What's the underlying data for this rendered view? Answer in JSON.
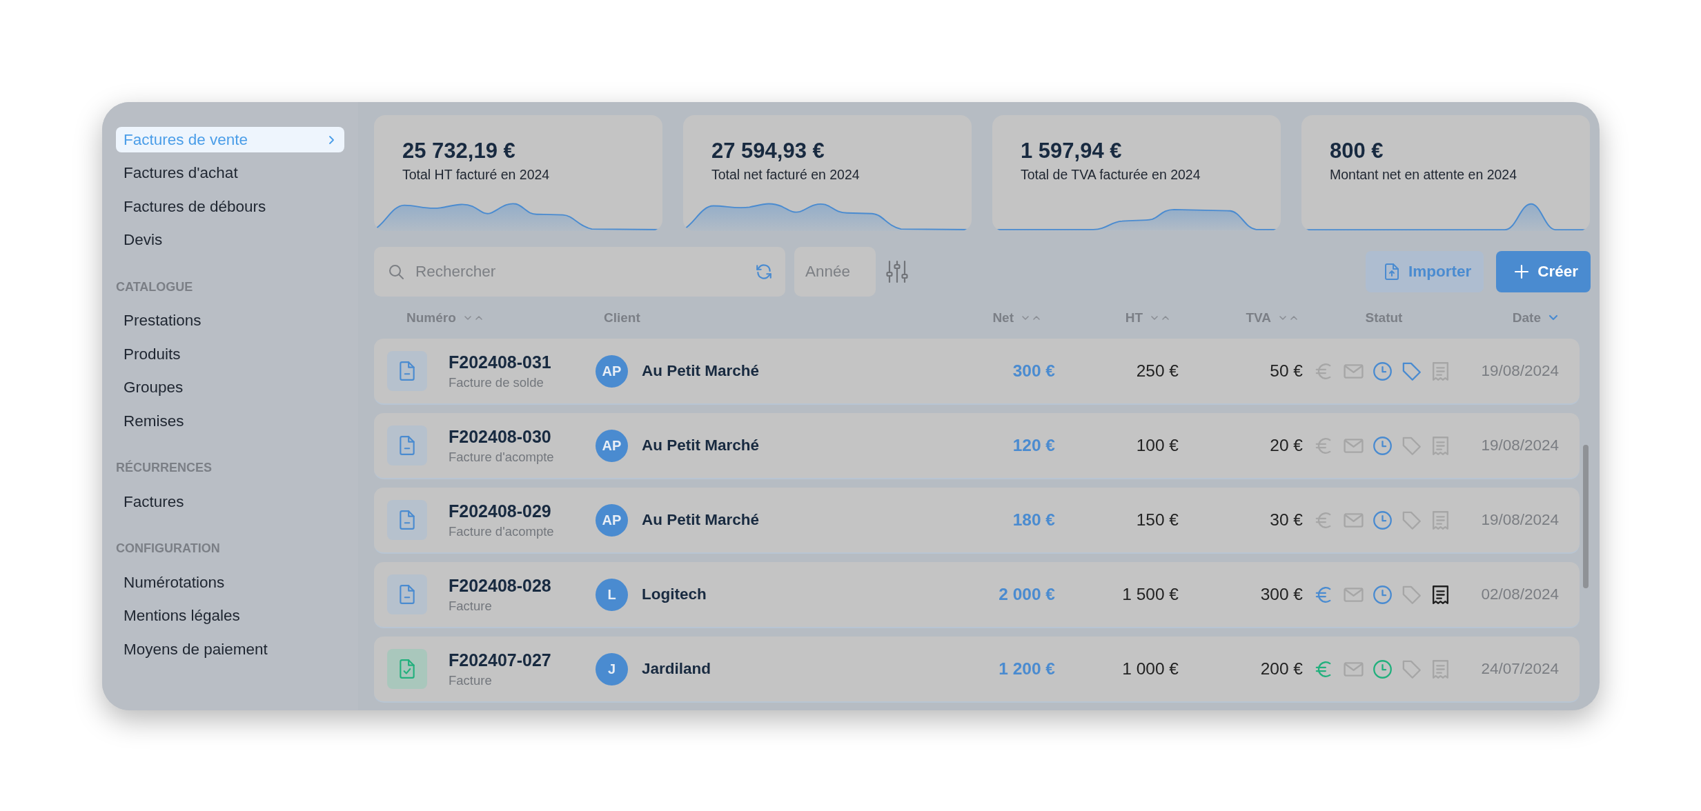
{
  "sidebar": {
    "items": [
      {
        "label": "Factures de vente",
        "selected": true
      },
      {
        "label": "Factures d'achat",
        "selected": false
      },
      {
        "label": "Factures de débours",
        "selected": false
      },
      {
        "label": "Devis",
        "selected": false
      }
    ],
    "sections": [
      {
        "title": "CATALOGUE",
        "items": [
          {
            "label": "Prestations",
            "selected": false
          },
          {
            "label": "Produits",
            "selected": false
          },
          {
            "label": "Groupes",
            "selected": false
          },
          {
            "label": "Remises",
            "selected": false
          }
        ]
      },
      {
        "title": "RÉCURRENCES",
        "items": [
          {
            "label": "Factures",
            "selected": false
          }
        ]
      },
      {
        "title": "CONFIGURATION",
        "items": [
          {
            "label": "Numérotations",
            "selected": false
          },
          {
            "label": "Mentions légales",
            "selected": false
          },
          {
            "label": "Moyens de paiement",
            "selected": false
          }
        ]
      }
    ]
  },
  "stats": [
    {
      "value": "25 732,19 €",
      "label": "Total HT facturé en 2024"
    },
    {
      "value": "27 594,93 €",
      "label": "Total net facturé en 2024"
    },
    {
      "value": "1 597,94 €",
      "label": "Total de TVA facturée en 2024"
    },
    {
      "value": "800 €",
      "label": "Montant net en attente en 2024"
    }
  ],
  "toolbar": {
    "search": {
      "placeholder": "Rechercher"
    },
    "year": {
      "placeholder": "Année"
    },
    "buttons": [
      {
        "label": "Importer",
        "kind": "import"
      },
      {
        "label": "Créer",
        "kind": "create"
      }
    ]
  },
  "table": {
    "columns": [
      {
        "label": "Numéro",
        "sorted": false
      },
      {
        "label": "Client"
      },
      {
        "label": "Net",
        "sorted": false
      },
      {
        "label": "HT",
        "sorted": false
      },
      {
        "label": "TVA",
        "sorted": false
      },
      {
        "label": "Statut"
      },
      {
        "label": "Date",
        "sorted": true
      }
    ],
    "rows": [
      {
        "number": "F202408-031",
        "type": "Facture de solde",
        "paid": false,
        "initials": "AP",
        "client": "Au Petit Marché",
        "net": "300 €",
        "ht": "250 €",
        "tva": "50 €",
        "status": [
          {
            "kind": "euro",
            "color": "#a6a6a6"
          },
          {
            "kind": "mail",
            "color": "#a6a6a6"
          },
          {
            "kind": "clock",
            "color": "#4a8bd0"
          },
          {
            "kind": "tag",
            "color": "#4a8bd0"
          },
          {
            "kind": "receipt",
            "color": "#a6a6a6"
          }
        ],
        "date": "19/08/2024"
      },
      {
        "number": "F202408-030",
        "type": "Facture d'acompte",
        "paid": false,
        "initials": "AP",
        "client": "Au Petit Marché",
        "net": "120 €",
        "ht": "100 €",
        "tva": "20 €",
        "status": [
          {
            "kind": "euro",
            "color": "#a6a6a6"
          },
          {
            "kind": "mail",
            "color": "#a6a6a6"
          },
          {
            "kind": "clock",
            "color": "#4a8bd0"
          },
          {
            "kind": "tag",
            "color": "#a6a6a6"
          },
          {
            "kind": "receipt",
            "color": "#a6a6a6"
          }
        ],
        "date": "19/08/2024"
      },
      {
        "number": "F202408-029",
        "type": "Facture d'acompte",
        "paid": false,
        "initials": "AP",
        "client": "Au Petit Marché",
        "net": "180 €",
        "ht": "150 €",
        "tva": "30 €",
        "status": [
          {
            "kind": "euro",
            "color": "#a6a6a6"
          },
          {
            "kind": "mail",
            "color": "#a6a6a6"
          },
          {
            "kind": "clock",
            "color": "#4a8bd0"
          },
          {
            "kind": "tag",
            "color": "#a6a6a6"
          },
          {
            "kind": "receipt",
            "color": "#a6a6a6"
          }
        ],
        "date": "19/08/2024"
      },
      {
        "number": "F202408-028",
        "type": "Facture",
        "paid": false,
        "initials": "L",
        "client": "Logitech",
        "net": "2 000 €",
        "ht": "1 500 €",
        "tva": "300 €",
        "status": [
          {
            "kind": "euro",
            "color": "#4a8bd0"
          },
          {
            "kind": "mail",
            "color": "#a6a6a6"
          },
          {
            "kind": "clock",
            "color": "#4a8bd0"
          },
          {
            "kind": "tag",
            "color": "#a6a6a6"
          },
          {
            "kind": "receipt",
            "color": "#1f1f1f"
          }
        ],
        "date": "02/08/2024"
      },
      {
        "number": "F202407-027",
        "type": "Facture",
        "paid": true,
        "initials": "J",
        "client": "Jardiland",
        "net": "1 200 €",
        "ht": "1 000 €",
        "tva": "200 €",
        "status": [
          {
            "kind": "euro",
            "color": "#22b07d"
          },
          {
            "kind": "mail",
            "color": "#a6a6a6"
          },
          {
            "kind": "clock",
            "color": "#22b07d"
          },
          {
            "kind": "tag",
            "color": "#a6a6a6"
          },
          {
            "kind": "receipt",
            "color": "#a6a6a6"
          }
        ],
        "date": "24/07/2024"
      }
    ]
  }
}
